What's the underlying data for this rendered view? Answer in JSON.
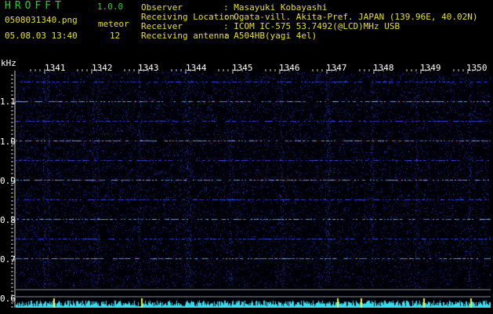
{
  "header": {
    "app_title": "HROFFT",
    "app_version": "1.0.0",
    "file_name": "0508031340.png",
    "meteor_label": "meteor",
    "datetime": "05.08.03 13:40",
    "meteor_count": "12",
    "info": [
      {
        "label": "Observer",
        "value": ": Masayuki Kobayashi"
      },
      {
        "label": "Receiving Location",
        "value": ": Ogata-vill. Akita-Pref. JAPAN (139.96E, 40.02N)"
      },
      {
        "label": "Receiver",
        "value": ": ICOM IC-575 53.7492(@LCD)MHz USB"
      },
      {
        "label": "Receiving antenna",
        "value": ": A504HB(yagi 4el)"
      }
    ]
  },
  "spectrogram": {
    "freq_unit": "kHz",
    "time_labels": [
      "1341",
      "1342",
      "1343",
      "1344",
      "1345",
      "1346",
      "1347",
      "1348",
      "1349",
      "1350"
    ],
    "freq_labels": [
      "1.1",
      "1.0",
      "0.9",
      "0.8",
      "0.7",
      "0.6"
    ],
    "colors": {
      "background": "#000008",
      "signal": "#2a40ff",
      "tone": "#4fc0ff",
      "activity": "#33ddee",
      "meteor": "#f0f040"
    }
  }
}
